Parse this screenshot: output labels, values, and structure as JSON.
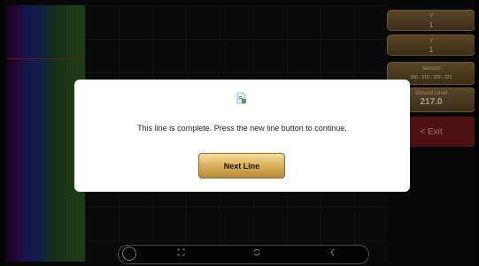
{
  "panel": {
    "box1": {
      "label": "Y",
      "value": "1"
    },
    "box2": {
      "label": "Y",
      "value": "1"
    },
    "sensors": {
      "label": "Sensors",
      "value": "200 - 210 - 220 - 221"
    },
    "ground_level": {
      "label": "Ground Level",
      "value": "217.0"
    },
    "exit_label": "< Exit"
  },
  "dialog": {
    "message": "This line is complete. Press the new line button to continue.",
    "button_label": "Next Line"
  },
  "nav": {
    "icons": [
      "home-circle",
      "screenshot-icon",
      "rotate-icon",
      "back-icon"
    ]
  },
  "colors": {
    "gold": "#c89a48",
    "exit_red": "#7a1c1c",
    "dialog_bg": "#ffffff"
  }
}
